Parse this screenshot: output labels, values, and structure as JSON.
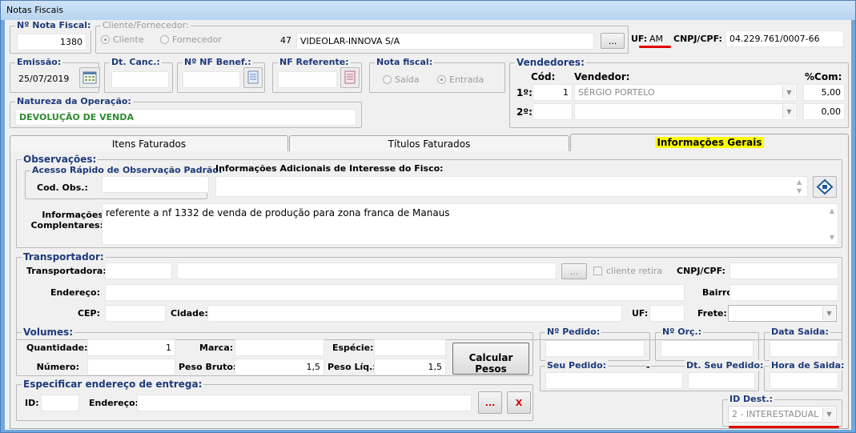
{
  "window": {
    "title": "Notas Fiscais"
  },
  "header": {
    "nf_label": "Nº Nota Fiscal:",
    "nf_value": "1380",
    "cliente_group_label": "Cliente/Fornecedor:",
    "radio_cliente": "Cliente",
    "radio_fornecedor": "Fornecedor",
    "cliente_code": "47",
    "cliente_name": "VIDEOLAR-INNOVA S/A",
    "ellipsis_label": "...",
    "uf_label": "UF:",
    "uf_value": "AM",
    "cnpj_label": "CNPJ/CPF:",
    "cnpj_value": "04.229.761/0007-66"
  },
  "dates": {
    "emissao_label": "Emissão:",
    "emissao_value": "25/07/2019",
    "dt_canc_label": "Dt. Canc.:",
    "nf_benef_label": "Nº NF Benef.:",
    "nf_referente_label": "NF Referente:",
    "nota_fiscal_label": "Nota fiscal:",
    "radio_saida": "Saída",
    "radio_entrada": "Entrada"
  },
  "natureza": {
    "label": "Natureza da Operação:",
    "value": "DEVOLUÇÃO DE VENDA"
  },
  "vendedores": {
    "label": "Vendedores:",
    "col_cod": "Cód:",
    "col_vendedor": "Vendedor:",
    "col_com": "%Com:",
    "row1_label": "1º:",
    "row1_cod": "1",
    "row1_name": "SÉRGIO PORTELO",
    "row1_com": "5,00",
    "row2_label": "2º:",
    "row2_com": "0,00"
  },
  "tabs": [
    {
      "label": "Itens Faturados"
    },
    {
      "label": "Títulos Faturados"
    },
    {
      "label": "Informações Gerais"
    }
  ],
  "observacoes": {
    "label": "Observações:",
    "acesso_label": "Acesso Rápido de Observação Padrão:",
    "cod_obs_label": "Cod. Obs.:",
    "info_fisco_label": "Informações Adicionais de Interesse do Fisco:",
    "info_comp_label_1": "Informações",
    "info_comp_label_2": "Complentares:",
    "info_comp_value": "referente a nf 1332 de venda de produção para zona franca de Manaus"
  },
  "transportador": {
    "label": "Transportador:",
    "transportadora_label": "Transportadora:",
    "ellipsis_label": "...",
    "cliente_retira_label": "cliente retira",
    "cnpj_label": "CNPJ/CPF:",
    "endereco_label": "Endereço:",
    "bairro_label": "Bairro:",
    "cep_label": "CEP:",
    "cidade_label": "Cidade:",
    "uf_label": "UF:",
    "frete_label": "Frete:"
  },
  "volumes": {
    "label": "Volumes:",
    "quantidade_label": "Quantidade:",
    "quantidade_value": "1",
    "marca_label": "Marca:",
    "especie_label": "Espécie:",
    "numero_label": "Número:",
    "peso_bruto_label": "Peso Bruto:",
    "peso_bruto_value": "1,5",
    "peso_liq_label": "Peso Líq.:",
    "peso_liq_value": "1,5",
    "calcular_label": "Calcular Pesos"
  },
  "entrega": {
    "label": "Especificar endereço de entrega:",
    "id_label": "ID:",
    "endereco_label": "Endereço:",
    "ellipsis_label": "...",
    "close_label": "X"
  },
  "pedido": {
    "n_pedido_label": "Nº Pedido:",
    "n_orc_label": "Nº Orç.:",
    "data_saida_label": "Data Saida:",
    "seu_pedido_label": "Seu Pedido:",
    "seu_pedido_dash": "-",
    "dt_seu_pedido_label": "Dt. Seu Pedido:",
    "hora_saida_label": "Hora de Saida:"
  },
  "id_dest": {
    "label": "ID Dest.:",
    "value": "2 - INTERESTADUAL"
  },
  "colors": {
    "group_label": "#1e3a7a",
    "natureza_text": "#2e8b2e",
    "active_tab": "#ffff00",
    "highlight_line": "#e00000"
  }
}
